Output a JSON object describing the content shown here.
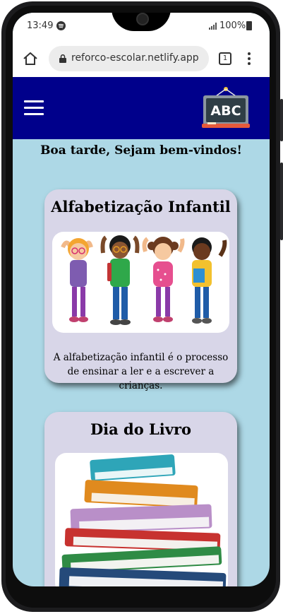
{
  "status": {
    "time": "13:49",
    "battery": "100%"
  },
  "browser": {
    "url": "reforco-escolar.netlify.app",
    "tab_count": "1"
  },
  "header": {
    "logo_text": "ABC"
  },
  "greeting": "Boa tarde, Sejam bem-vindos!",
  "cards": [
    {
      "title": "Alfabetização Infantil",
      "text": "A alfabetização infantil é o processo de ensinar a ler e a escrever a crianças."
    },
    {
      "title": "Dia do Livro"
    }
  ],
  "colors": {
    "page_bg": "#add8e6",
    "header_bg": "#00008b",
    "card_bg": "#d8d6e8"
  }
}
